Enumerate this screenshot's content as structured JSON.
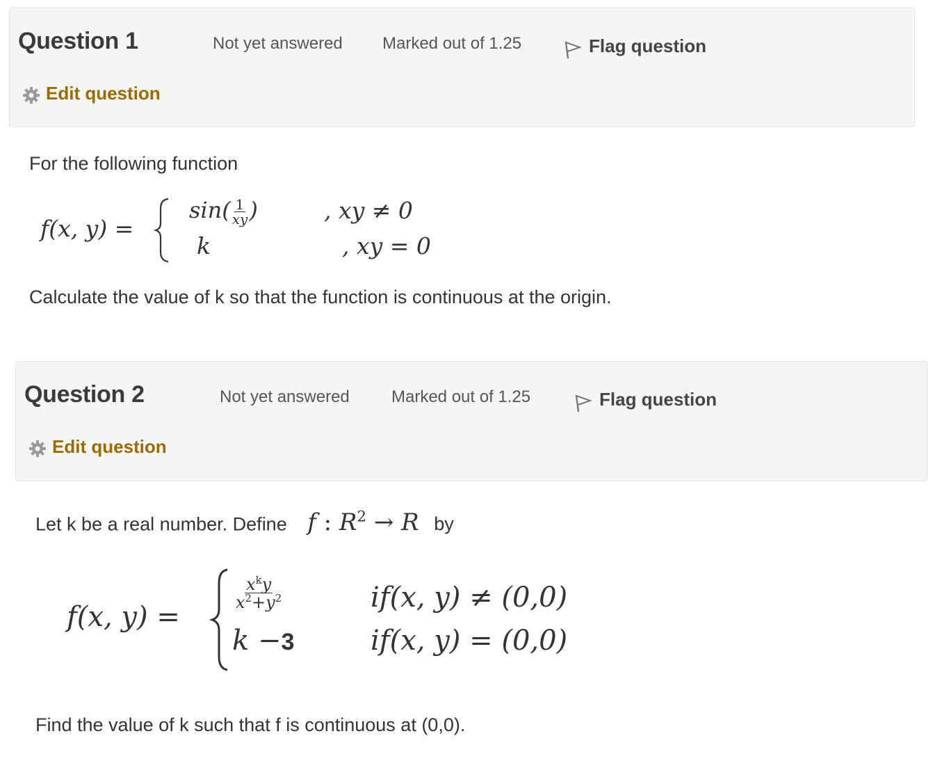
{
  "questions": [
    {
      "number_label": "Question",
      "number": "1",
      "state": "Not yet answered",
      "grade": "Marked out of 1.25",
      "flag_label": "Flag question",
      "edit_label": "Edit question",
      "intro": "For the following function",
      "lhs": "f(x, y) =",
      "case1_expr_prefix": "sin(",
      "case1_frac_num": "1",
      "case1_frac_den": "xy",
      "case1_expr_suffix": ")",
      "case1_cond": ", xy ≠ 0",
      "case2_expr": "k",
      "case2_cond": ", xy = 0",
      "prompt": "Calculate the value of k so that the function is continuous at the origin."
    },
    {
      "number_label": "Question",
      "number": "2",
      "state": "Not yet answered",
      "grade": "Marked out of 1.25",
      "flag_label": "Flag question",
      "edit_label": "Edit question",
      "intro_before": "Let k be a real number. Define",
      "intro_math_f": "f",
      "intro_math_colon": ":",
      "intro_math_r": "R",
      "intro_math_exp": "2",
      "intro_math_arrow": "→",
      "intro_math_r2": "R",
      "intro_after": "by",
      "lhs": "f(x, y) =",
      "case1_num_x": "x",
      "case1_num_exp": "k",
      "case1_num_y": "y",
      "case1_den_x": "x",
      "case1_den_exp1": "2",
      "case1_den_plus": "+",
      "case1_den_y": "y",
      "case1_den_exp2": "2",
      "case1_cond": "if(x, y) ≠ (0,0)",
      "case2_k": "k",
      "case2_minus": "−",
      "case2_num": "3",
      "case2_cond": "if(x, y) = (0,0)",
      "prompt": "Find the value of k such that f is continuous at (0,0)."
    }
  ]
}
